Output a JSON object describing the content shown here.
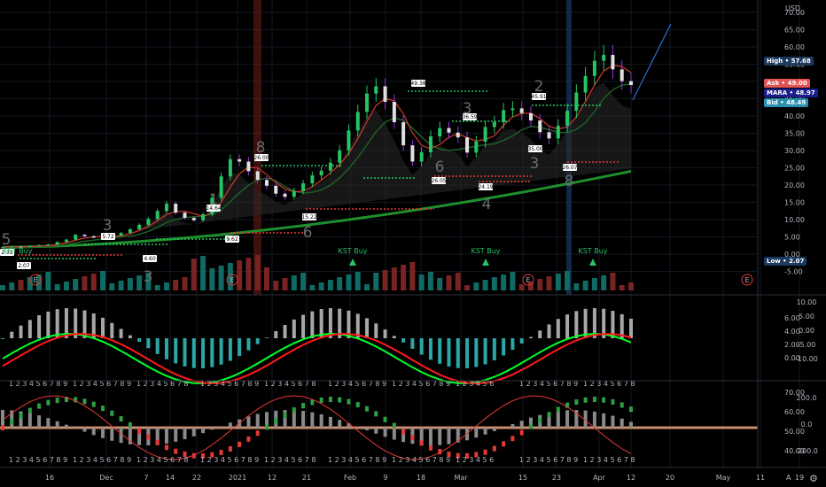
{
  "currency": "USD",
  "price_tags": {
    "high": {
      "label": "High",
      "value": "57.68",
      "color": "#1c3a5e"
    },
    "ask": {
      "label": "Ask",
      "value": "49.00",
      "color": "#e25353"
    },
    "last": {
      "label": "MARA",
      "value": "48.97",
      "color": "#1a1f8e"
    },
    "bid": {
      "label": "Bid",
      "value": "48.49",
      "color": "#2b8fb0"
    },
    "low": {
      "label": "Low",
      "value": "2.07",
      "color": "#1c3a5e"
    }
  },
  "chart_data": [
    {
      "type": "candlestick",
      "y_ticks": [
        "70.00",
        "65.00",
        "60.00",
        "55.00",
        "50.00",
        "45.00",
        "40.00",
        "35.00",
        "30.00",
        "25.00",
        "20.00",
        "15.00",
        "10.00",
        "5.00",
        "0.00",
        "-5.00"
      ],
      "ylim": [
        -5,
        72
      ],
      "x_ticks": [
        "16",
        "Dec",
        "7",
        "14",
        "22",
        "2021",
        "12",
        "21",
        "Feb",
        "9",
        "18",
        "Mar",
        "15",
        "23",
        "Apr",
        "12",
        "20",
        "May",
        "11",
        "19"
      ],
      "price_path": [
        2,
        2.2,
        2.1,
        2.4,
        2.6,
        2.8,
        3.5,
        4.2,
        5.6,
        5.2,
        4.8,
        5.0,
        5.4,
        6.1,
        7.2,
        8.5,
        10.2,
        12.5,
        14.6,
        12.0,
        10.5,
        9.8,
        11.5,
        16.3,
        22.5,
        27.5,
        26.8,
        24.0,
        21.5,
        19.8,
        17.5,
        16.6,
        18.3,
        20.5,
        22.8,
        24.2,
        26.5,
        30.1,
        35.8,
        41.2,
        46.5,
        48.6,
        44.1,
        38.2,
        31.5,
        26.8,
        29.5,
        34.1,
        36.5,
        35.2,
        33.8,
        29.4,
        32.6,
        36.8,
        38.2,
        41.7,
        42.2,
        40.8,
        38.7,
        35.3,
        33.5,
        37.2,
        41.5,
        46.8,
        51.6,
        56.0,
        57.7,
        53.5,
        50.1,
        48.97
      ],
      "price_labels": [
        {
          "text": "2.33"
        },
        {
          "text": "2.07"
        },
        {
          "text": "5.72"
        },
        {
          "text": "4.60"
        },
        {
          "text": "14.64"
        },
        {
          "text": "9.62"
        },
        {
          "text": "26.00"
        },
        {
          "text": "15.22"
        },
        {
          "text": "49.38"
        },
        {
          "text": "26.05"
        },
        {
          "text": "36.59"
        },
        {
          "text": "24.19"
        },
        {
          "text": "45.91"
        },
        {
          "text": "35.00"
        },
        {
          "text": "26.07"
        }
      ],
      "wave_counts": [
        "5",
        "3",
        "3",
        "1",
        "8",
        "6",
        "6",
        "3",
        "4",
        "2",
        "3",
        "8"
      ],
      "annotations": [
        "KST Buy",
        "KST Buy",
        "KST Buy"
      ],
      "earnings_markers": [
        "E",
        "E",
        "E",
        "E"
      ]
    },
    {
      "type": "line",
      "y_ticks_right": [
        "10.00",
        "5.00",
        "0.00",
        "-5.00",
        "-10.00"
      ],
      "y_ticks_left": [
        "6.00",
        "4.00",
        "2.00",
        "0.00"
      ],
      "series": [
        {
          "color": "#00ff2a"
        },
        {
          "color": "#ff1a1a"
        }
      ]
    },
    {
      "type": "line",
      "y_ticks_right_a": [
        "200.0",
        "0.0",
        "-200.0"
      ],
      "y_ticks_right_b": [
        "70.00",
        "60.00",
        "50.00",
        "40.00"
      ],
      "sequence_text": [
        "1 2 3 4 5 6 7 8 9",
        "1 2 3 4 5 6 7 8 9",
        "1 2 3 4 5 6 7 8",
        "1 2 3 4 5 6 7 8 9",
        "1 2 3 4 5 6 7 8",
        "1 2 3 4 5 6 7 8 9",
        "1 2 3 4 5 6 7 8 9",
        "1 2 3 4 5 6",
        "1 2 3 4 5 6 7 8 9",
        "1 2 3 4 5 6 7 8"
      ]
    }
  ]
}
